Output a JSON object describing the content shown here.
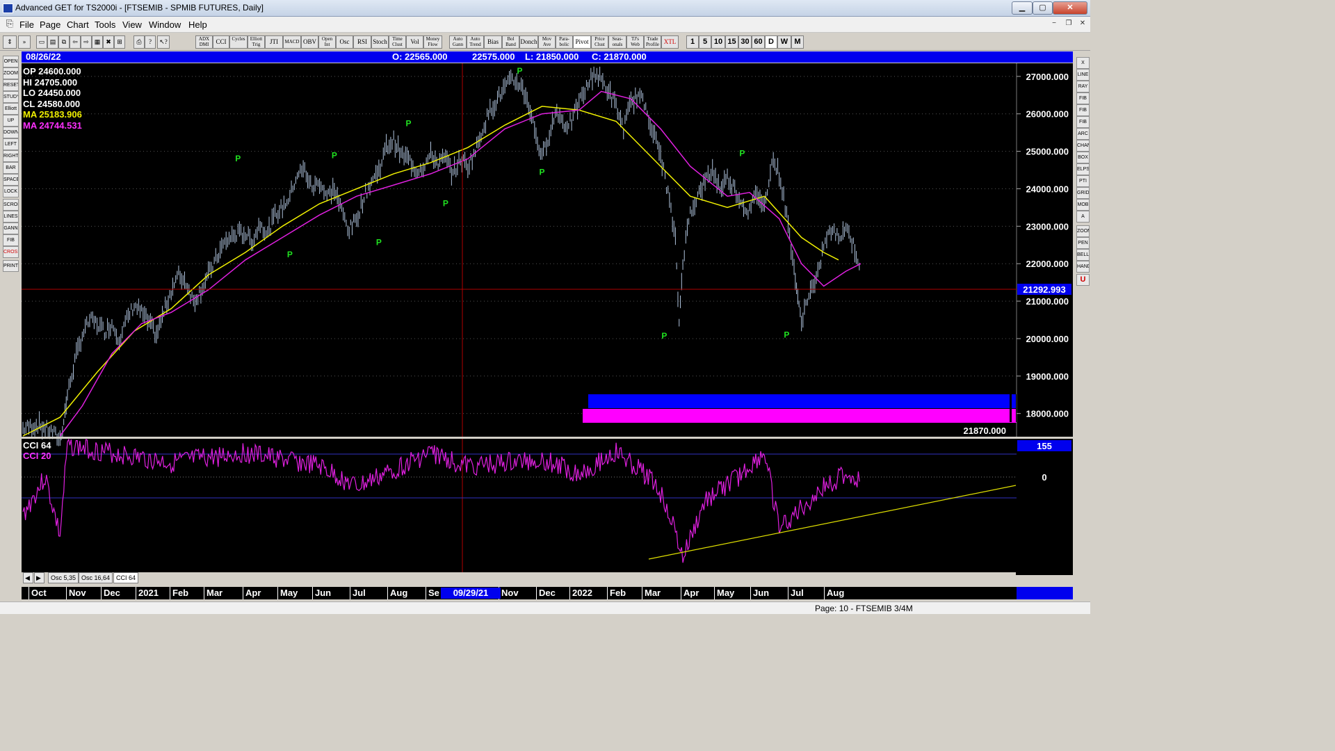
{
  "window": {
    "title": "Advanced GET for TS2000i - [FTSEMIB - SPMIB FUTURES, Daily]",
    "minimize": "▁",
    "maximize": "▢",
    "close": "✕"
  },
  "menu": [
    "File",
    "Page",
    "Chart",
    "Tools",
    "View",
    "Window",
    "Help"
  ],
  "toolbar": {
    "study_buttons": [
      "ADX DMI",
      "CCI",
      "Cycles",
      "Elliott Trig",
      "JTI",
      "MACD",
      "OBV",
      "Open Int",
      "Osc",
      "RSI",
      "Stoch",
      "Time Clust",
      "Vol",
      "Money Flow",
      "Auto Gann",
      "Auto Trend",
      "Bias",
      "Bol Band",
      "Donch",
      "Mov Ave",
      "Para-bolic",
      "Pivot",
      "Price Clust",
      "Seas-onals",
      "TJ's Web",
      "Trade Profile",
      "XTL"
    ],
    "period_buttons": [
      "1",
      "5",
      "10",
      "15",
      "30",
      "60",
      "D",
      "W",
      "M"
    ]
  },
  "left_tools": [
    "OPEN",
    "ZOOM",
    "RESET",
    "STUDY",
    "Elliott",
    "UP",
    "DOWN",
    "LEFT",
    "RIGHT",
    "BAR",
    "SPACE",
    "LOCK",
    "SCROLL",
    "LINES",
    "GANN",
    "FIB",
    "CROSS",
    "PRINT"
  ],
  "right_tools": [
    "X",
    "LINE",
    "RAY",
    "FIB RET",
    "FIB EXT",
    "FIB TIME",
    "ARC",
    "CHAN",
    "BOX",
    "ELPS",
    "PTI",
    "GRID",
    "MOB",
    "A",
    "ZOOM",
    "PEN",
    "BELL",
    "HAND",
    "U"
  ],
  "infobar": {
    "date": "08/26/22",
    "open": "O: 22565.000",
    "high": "22575.000",
    "low": "L: 21850.000",
    "close": "C: 21870.000"
  },
  "data_window": {
    "op": "OP  24600.000",
    "hi": "HI   24705.000",
    "lo": "LO   24450.000",
    "cl": "CL   24580.000",
    "ma1": "MA  25183.906",
    "ma2": "MA  24744.531"
  },
  "indicator_labels": {
    "cci64": "CCI 64",
    "cci20": "CCI  20"
  },
  "tabs": [
    "Osc 5,35",
    "Osc 16,64",
    "CCI 64"
  ],
  "status": "Page: 10 - FTSEMIB 3/4M",
  "colors": {
    "price": "#b0c4de",
    "ma_yellow": "#f0f000",
    "ma_magenta": "#e020e0",
    "pivot": "#20e020",
    "info_blue": "#0000ee",
    "box_blue": "#0000ff",
    "box_magenta": "#ff00ff",
    "crosshair": "#d00000"
  },
  "chart_data": {
    "type": "line",
    "symbol": "FTSEMIB - SPMIB FUTURES",
    "period": "Daily",
    "y_ticks": [
      27000,
      26000,
      25000,
      24000,
      23000,
      22000,
      21000,
      20000,
      19000,
      18000
    ],
    "y_tick_labels": [
      "27000.000",
      "26000.000",
      "25000.000",
      "24000.000",
      "23000.000",
      "22000.000",
      "21000.000",
      "20000.000",
      "19000.000",
      "18000.000"
    ],
    "ylim": [
      17400,
      27350
    ],
    "cursor_price": "21292.993",
    "last_close_label": "21870.000",
    "x_month_labels": [
      "Oct",
      "Nov",
      "Dec",
      "2021",
      "Feb",
      "Mar",
      "Apr",
      "May",
      "Jun",
      "Jul",
      "Aug",
      "Se",
      "Nov",
      "Dec",
      "2022",
      "Feb",
      "Mar",
      "Apr",
      "May",
      "Jun",
      "Jul",
      "Aug"
    ],
    "cursor_date": "09/29/21",
    "x_index_range": [
      0,
      100
    ],
    "price_series": [
      [
        0,
        17600
      ],
      [
        2,
        17700
      ],
      [
        4,
        17500
      ],
      [
        5,
        17300
      ],
      [
        5.5,
        17800
      ],
      [
        6,
        18500
      ],
      [
        7,
        19400
      ],
      [
        8,
        20100
      ],
      [
        9,
        20500
      ],
      [
        10,
        20400
      ],
      [
        11,
        20200
      ],
      [
        12,
        20400
      ],
      [
        13,
        20000
      ],
      [
        14,
        20500
      ],
      [
        15,
        20900
      ],
      [
        16,
        20700
      ],
      [
        17,
        20400
      ],
      [
        18,
        20100
      ],
      [
        19,
        20700
      ],
      [
        20,
        21300
      ],
      [
        21,
        21700
      ],
      [
        22,
        21500
      ],
      [
        23,
        21000
      ],
      [
        24,
        21300
      ],
      [
        25,
        21700
      ],
      [
        26,
        22100
      ],
      [
        27,
        22500
      ],
      [
        28,
        22700
      ],
      [
        29,
        22800
      ],
      [
        30,
        22800
      ],
      [
        31,
        22600
      ],
      [
        32,
        23100
      ],
      [
        33,
        22800
      ],
      [
        34,
        23300
      ],
      [
        35,
        23500
      ],
      [
        36,
        23800
      ],
      [
        37,
        24400
      ],
      [
        38,
        24500
      ],
      [
        39,
        24000
      ],
      [
        40,
        24200
      ],
      [
        41,
        23800
      ],
      [
        42,
        24000
      ],
      [
        43,
        23400
      ],
      [
        44,
        22900
      ],
      [
        45,
        23200
      ],
      [
        46,
        23800
      ],
      [
        47,
        24200
      ],
      [
        48,
        24500
      ],
      [
        49,
        25100
      ],
      [
        50,
        25300
      ],
      [
        51,
        24900
      ],
      [
        52,
        24800
      ],
      [
        53,
        24500
      ],
      [
        54,
        24600
      ],
      [
        55,
        24900
      ],
      [
        56,
        24700
      ],
      [
        57,
        24800
      ],
      [
        58,
        24400
      ],
      [
        59,
        24800
      ],
      [
        60,
        24600
      ],
      [
        61,
        25000
      ],
      [
        62,
        25600
      ],
      [
        63,
        26100
      ],
      [
        64,
        26400
      ],
      [
        65,
        26700
      ],
      [
        66,
        26900
      ],
      [
        67,
        26800
      ],
      [
        68,
        26400
      ],
      [
        69,
        25600
      ],
      [
        70,
        24800
      ],
      [
        71,
        25500
      ],
      [
        72,
        26100
      ],
      [
        73,
        25700
      ],
      [
        74,
        25800
      ],
      [
        75,
        26300
      ],
      [
        76,
        26700
      ],
      [
        77,
        27100
      ],
      [
        78,
        26900
      ],
      [
        79,
        26600
      ],
      [
        80,
        26200
      ]
    ],
    "price_series_2": [
      [
        80,
        26200
      ],
      [
        81,
        25600
      ],
      [
        82,
        26300
      ],
      [
        83,
        26500
      ],
      [
        84,
        26200
      ],
      [
        85,
        25500
      ],
      [
        86,
        24900
      ],
      [
        87,
        23900
      ],
      [
        88,
        22600
      ],
      [
        88.5,
        20400
      ],
      [
        89,
        22100
      ],
      [
        90,
        23400
      ],
      [
        91,
        23800
      ],
      [
        92,
        24200
      ],
      [
        93,
        24500
      ],
      [
        94,
        24000
      ],
      [
        95,
        24300
      ],
      [
        96,
        24000
      ],
      [
        97,
        23600
      ],
      [
        98,
        23400
      ],
      [
        99,
        23900
      ],
      [
        100,
        23500
      ]
    ],
    "pivots_high": [
      [
        21,
        24660
      ],
      [
        38,
        24740
      ],
      [
        48,
        25600
      ],
      [
        57,
        27000
      ],
      [
        101,
        24800
      ]
    ],
    "pivots_low": [
      [
        35,
        22390
      ],
      [
        52,
        22720
      ],
      [
        59,
        23760
      ],
      [
        63,
        24590
      ],
      [
        88.7,
        20220
      ],
      [
        105,
        20250
      ]
    ],
    "note": "x values are bar index positions along the visible time axis (0 = left edge, ~113 = last bar)"
  }
}
